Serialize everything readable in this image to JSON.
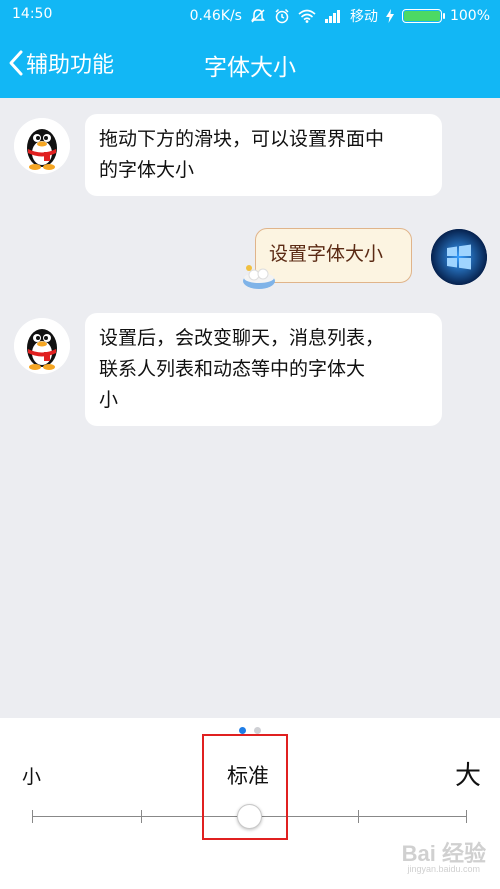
{
  "status_bar": {
    "time": "14:50",
    "speed": "0.46K/s",
    "carrier": "移动",
    "battery": "100%",
    "battery_level": 1.0,
    "icons": [
      "no-disturb-icon",
      "alarm-icon",
      "wifi-icon",
      "signal-icon",
      "charging-icon",
      "battery-icon"
    ]
  },
  "header": {
    "back_label": "辅助功能",
    "title": "字体大小",
    "background": "#12b7f5"
  },
  "chat": {
    "messages": [
      {
        "sender": "qq",
        "avatar": "penguin-avatar",
        "text_lines": [
          "拖动下方的滑块，可以设置界面中",
          "的字体大小"
        ]
      },
      {
        "sender": "me",
        "avatar": "windows-avatar",
        "text": "设置字体大小"
      },
      {
        "sender": "qq",
        "avatar": "penguin-avatar",
        "text_lines": [
          "设置后，会改变聊天，消息列表，",
          "联系人列表和动态等中的字体大",
          "小"
        ]
      }
    ]
  },
  "font_slider": {
    "page_indicator": {
      "pages": 2,
      "active": 0
    },
    "label_small": "小",
    "label_standard": "标准",
    "label_large": "大",
    "steps": 5,
    "selected_step": 2,
    "accent": "#1f7de6",
    "highlight_color": "#e02020"
  },
  "watermark": {
    "main": "Bai 经验",
    "sub": "jingyan.baidu.com"
  }
}
